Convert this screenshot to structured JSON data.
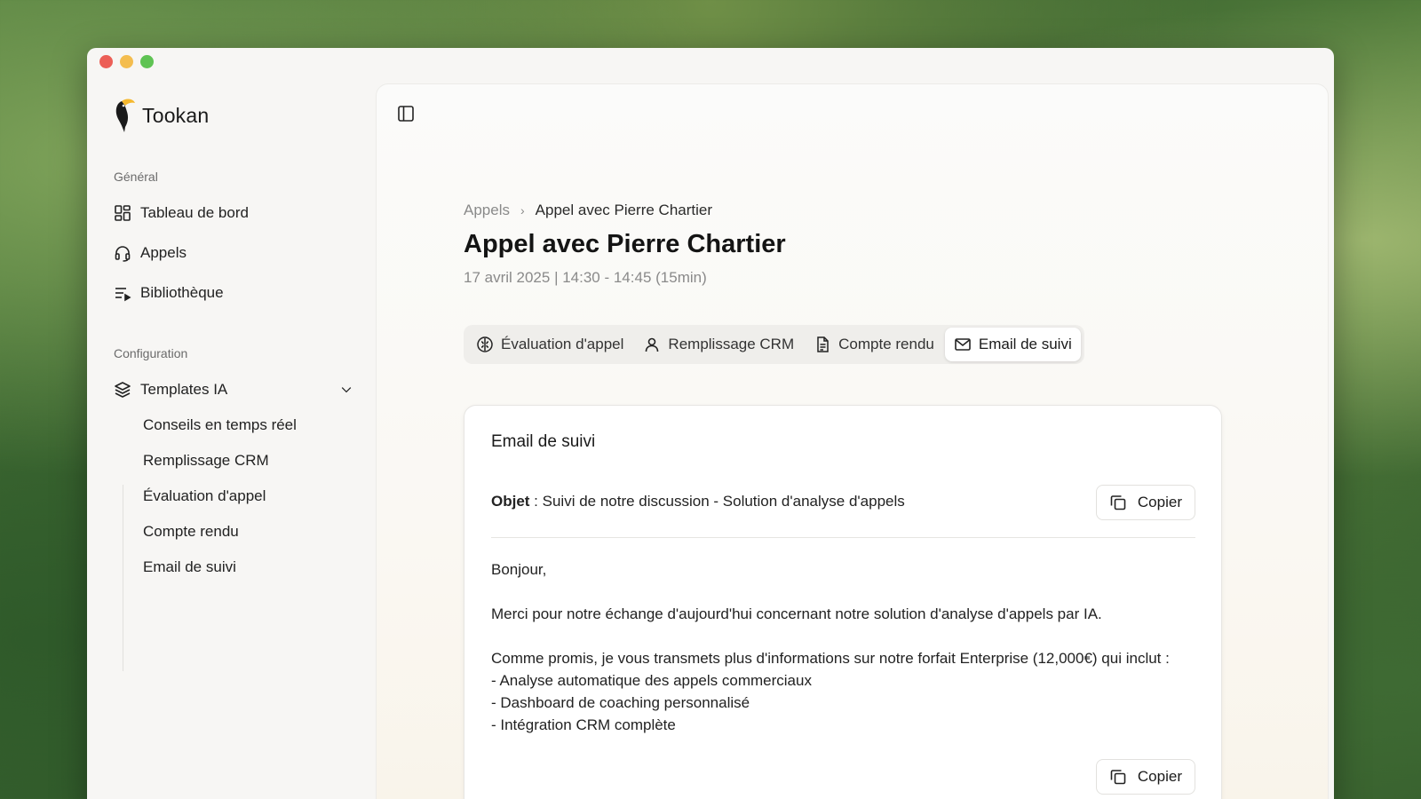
{
  "app": {
    "name": "Tookan"
  },
  "sidebar": {
    "sections": {
      "general": "Général",
      "configuration": "Configuration"
    },
    "items": [
      {
        "label": "Tableau de bord",
        "icon": "dashboard-icon"
      },
      {
        "label": "Appels",
        "icon": "headset-icon"
      },
      {
        "label": "Bibliothèque",
        "icon": "playlist-icon"
      }
    ],
    "templates": {
      "label": "Templates IA",
      "icon": "layers-icon",
      "expanded": true,
      "children": [
        "Conseils en temps réel",
        "Remplissage CRM",
        "Évaluation d'appel",
        "Compte rendu",
        "Email de suivi"
      ]
    }
  },
  "breadcrumb": {
    "parent": "Appels",
    "separator": "›",
    "current": "Appel avec Pierre Chartier"
  },
  "page": {
    "title": "Appel avec Pierre Chartier",
    "date": "17 avril 2025 | 14:30 - 14:45 (15min)"
  },
  "tabs": [
    {
      "label": "Évaluation d'appel",
      "icon": "brain-icon",
      "active": false
    },
    {
      "label": "Remplissage CRM",
      "icon": "user-icon",
      "active": false
    },
    {
      "label": "Compte rendu",
      "icon": "document-icon",
      "active": false
    },
    {
      "label": "Email de suivi",
      "icon": "mail-icon",
      "active": true
    }
  ],
  "email": {
    "title": "Email de suivi",
    "subject_label": "Objet",
    "subject_sep": " : ",
    "subject": "Suivi de notre discussion - Solution d'analyse d'appels",
    "copy_label": "Copier",
    "body": [
      "Bonjour,",
      "",
      "Merci pour notre échange d'aujourd'hui concernant notre solution d'analyse d'appels par IA.",
      "",
      "Comme promis, je vous transmets plus d'informations sur notre forfait Enterprise (12,000€) qui inclut :",
      "- Analyse automatique des appels commerciaux",
      "- Dashboard de coaching personnalisé",
      "- Intégration CRM complète"
    ]
  },
  "colors": {
    "accent_logo": "#f5b82e",
    "window_bg": "#f7f6f4",
    "card_bg": "#ffffff"
  }
}
